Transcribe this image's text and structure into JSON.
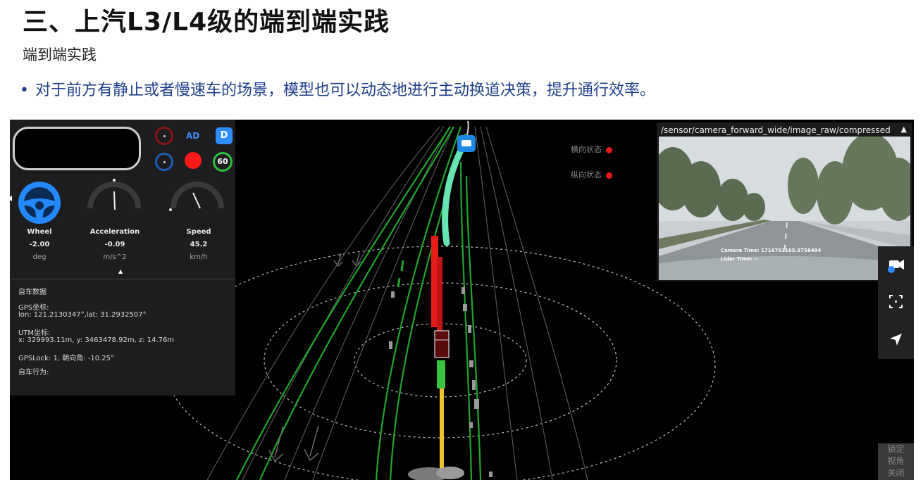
{
  "slide": {
    "title": "三、上汽L3/L4级的端到端实践",
    "subtitle": "端到端实践",
    "bullet": "对于前方有静止或者慢速车的场景，模型也可以动态地进行主动换道决策，提升通行效率。",
    "bullet_marker": "•"
  },
  "dashboard": {
    "mode_ad": "AD",
    "gear": "D",
    "speed_limit": "60",
    "gauges": [
      {
        "label": "Wheel",
        "value": "-2.00",
        "unit": "deg",
        "icon": "steering-wheel-icon"
      },
      {
        "label": "Acceleration",
        "value": "-0.09",
        "unit": "m/s^2"
      },
      {
        "label": "Speed",
        "value": "45.2",
        "unit": "km/h"
      }
    ],
    "collapse_caret": "▲",
    "colors": {
      "accent": "#2d8cff",
      "red": "#e81b1b",
      "green": "#27c13c"
    }
  },
  "ego_data": {
    "title": "自车数据",
    "gps_label": "GPS坐标:",
    "gps_value": "lon: 121.2130347°,lat: 31.2932507°",
    "utm_label": "UTM坐标:",
    "utm_value": "x: 329993.11m, y: 3463478.92m, z: 14.76m",
    "gpslock": "GPSLock: 1, 朝向角: -10.25°",
    "behavior_label": "自车行为:"
  },
  "status": {
    "lateral": "横向状态",
    "longitudinal": "纵向状态"
  },
  "camera": {
    "topic": "/sensor/camera_forward_wide/image_raw/compressed",
    "caret": "▲",
    "camera_time": "Camera Time: 1716701165.9756494",
    "lidar_time": "Lidar Time: --"
  },
  "toolbar": {
    "icons": [
      "camera-icon",
      "fullscreen-icon",
      "navigation-arrow-icon"
    ],
    "corner_lines": [
      "锁定",
      "视角",
      "关闭"
    ]
  }
}
